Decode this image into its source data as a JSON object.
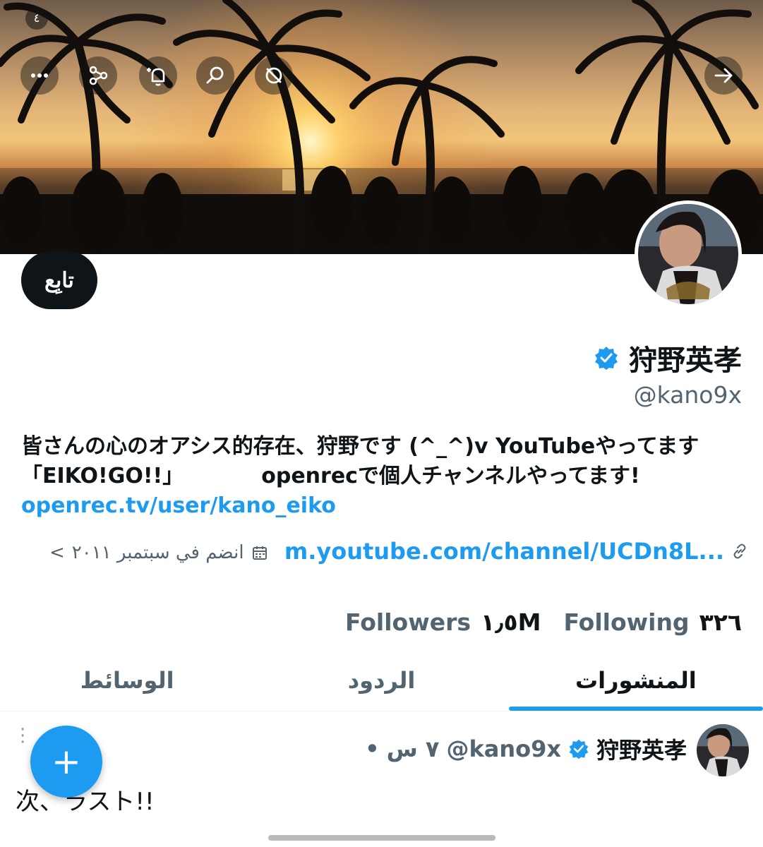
{
  "header": {
    "status_indicator": "٤",
    "buttons": [
      "more-icon",
      "share-icon",
      "notify-icon",
      "search-icon",
      "refresh-icon",
      "back-arrow-icon"
    ]
  },
  "profile": {
    "follow_label": "تابِع",
    "display_name": "狩野英孝",
    "handle": "@kano9x",
    "verified": true,
    "bio_part1": "皆さんの心のオアシス的存在、狩野です (^_^)v YouTubeやってます「EIKO!GO!!」",
    "bio_part2": "openrecで個人チャンネルやってます!",
    "bio_link": "openrec.tv/user/kano_eiko",
    "website": "m.youtube.com/channel/UCDn8L...",
    "joined": "انضم في سبتمبر ٢٠١١",
    "joined_chevron": "<",
    "followers_count": "١٫٥M",
    "followers_label": "Followers",
    "following_count": "٣٢٦",
    "following_label": "Following"
  },
  "tabs": [
    {
      "label": "المنشورات",
      "active": true
    },
    {
      "label": "الردود",
      "active": false
    },
    {
      "label": "الوسائط",
      "active": false
    }
  ],
  "post": {
    "name": "狩野英孝",
    "handle": "@kano9x",
    "time": "٧ س",
    "separator": "•",
    "text": "次、ラスト!!"
  },
  "fab_label": "+",
  "colors": {
    "accent": "#1d9bf0",
    "text": "#0f1419",
    "secondary": "#536471"
  }
}
